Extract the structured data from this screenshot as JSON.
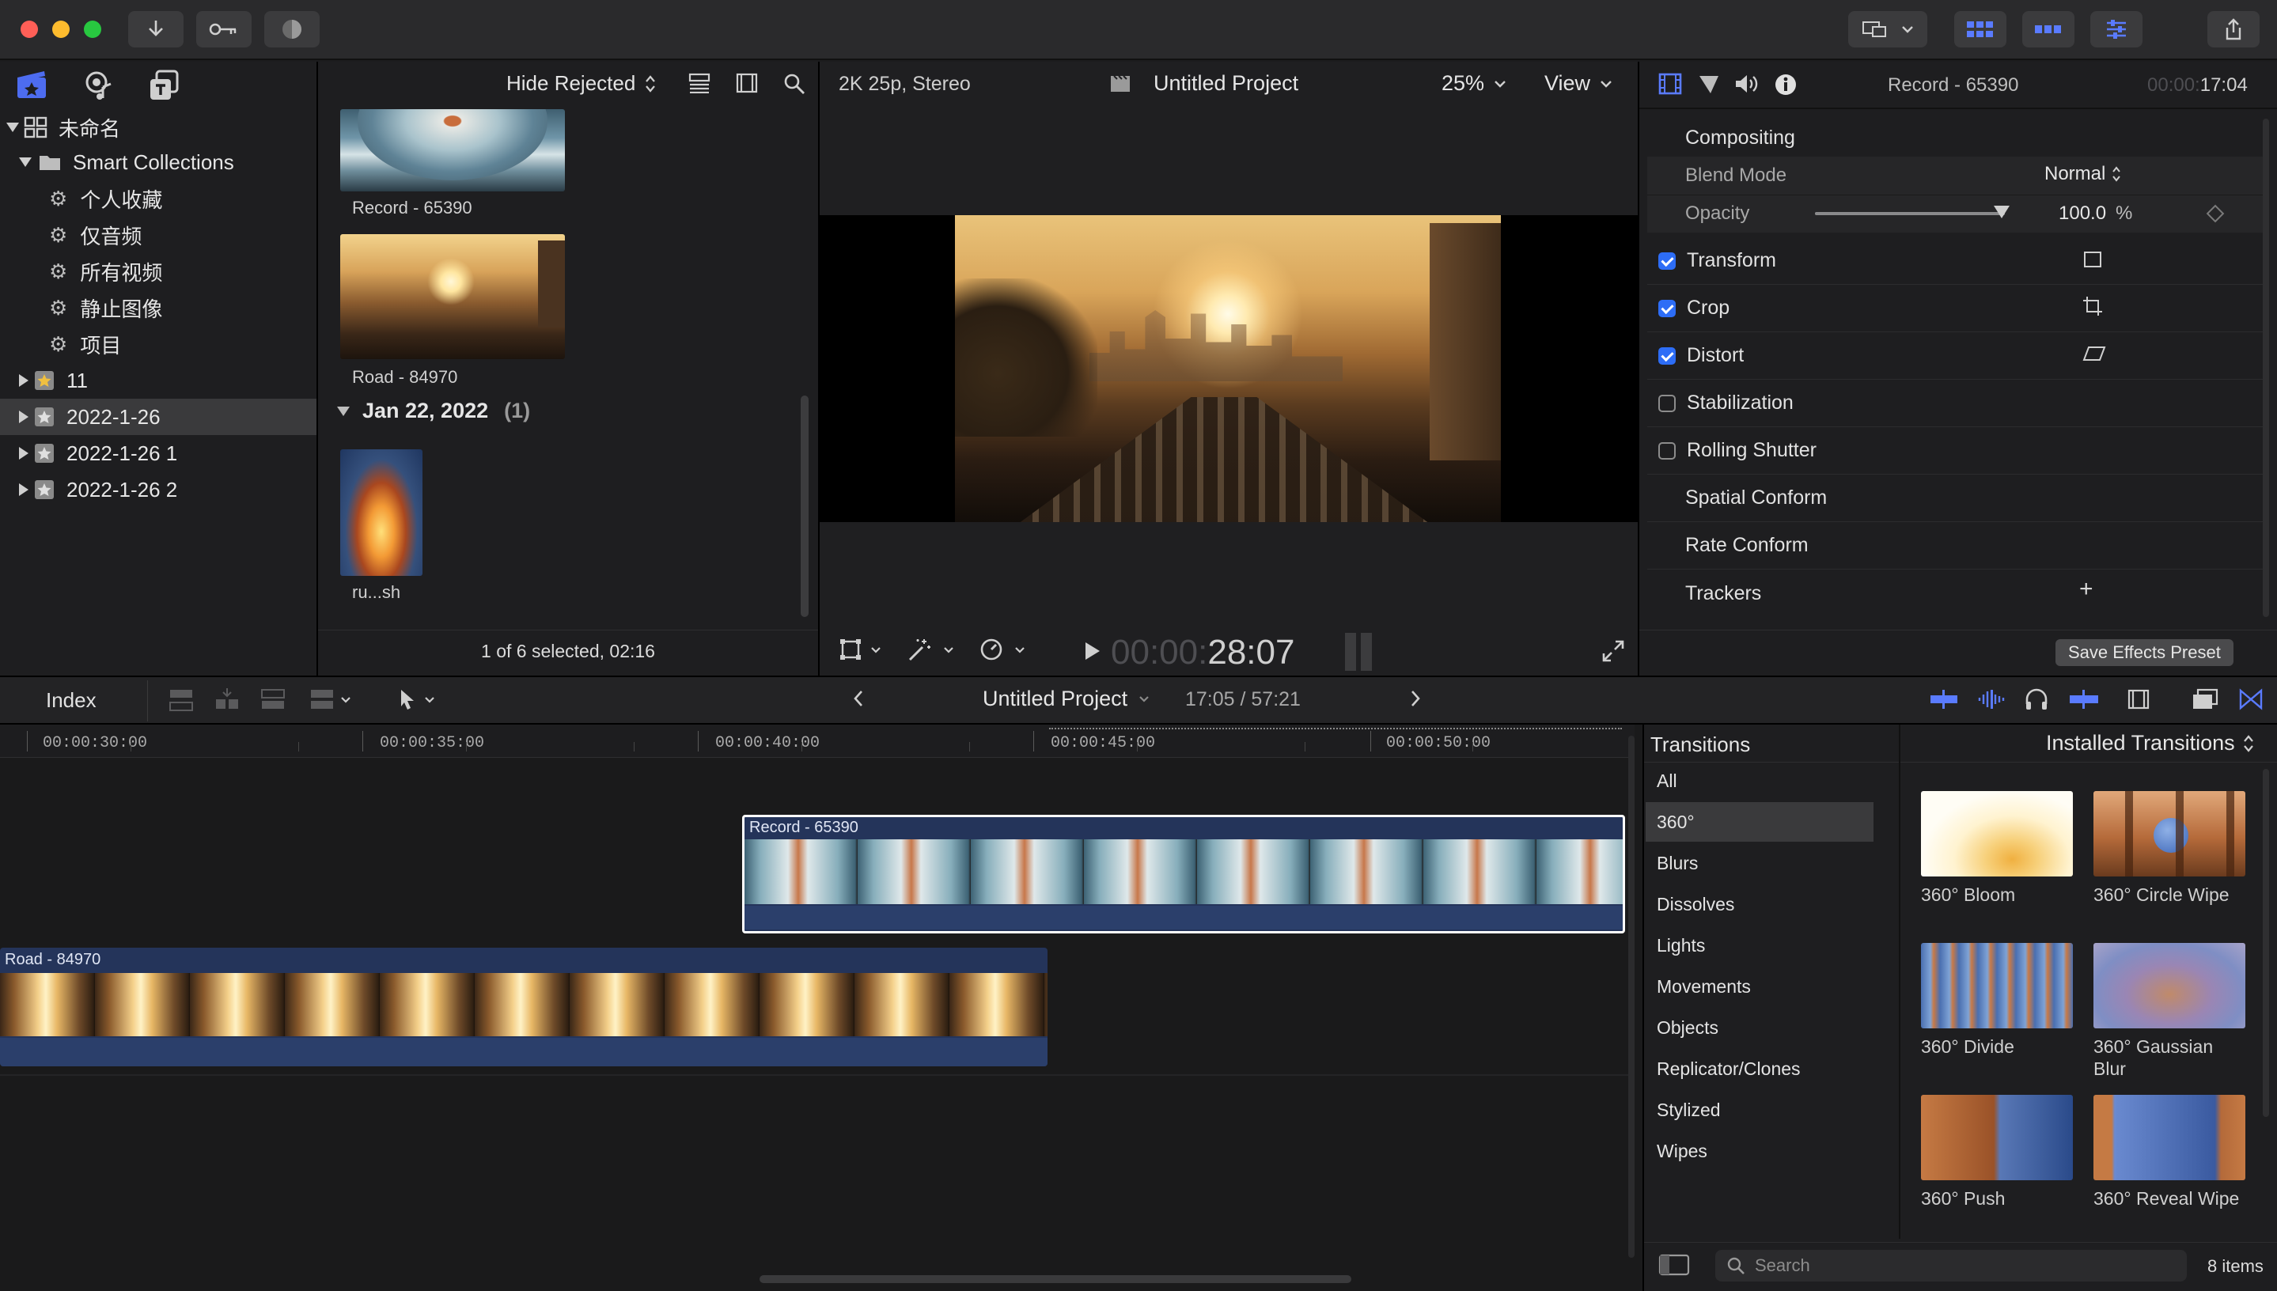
{
  "toolbar": {
    "import_icon": "download-arrow-icon",
    "keyword_icon": "key-icon",
    "bg_tasks_icon": "progress-circle-icon"
  },
  "browser_header": {
    "filter_label": "Hide Rejected"
  },
  "library": {
    "root": "未命名",
    "smart_collections_label": "Smart Collections",
    "smart_items": [
      "个人收藏",
      "仅音频",
      "所有视频",
      "静止图像",
      "项目"
    ],
    "events": [
      "11",
      "2022-1-26",
      "2022-1-26 1",
      "2022-1-26 2"
    ],
    "selected_event": "2022-1-26"
  },
  "browser": {
    "clips": [
      {
        "label": "Record - 65390"
      },
      {
        "label": "Road - 84970"
      }
    ],
    "date_group": "Jan 22, 2022",
    "date_group_count": "(1)",
    "clip3_label": "ru...sh",
    "status": "1 of 6 selected, 02:16"
  },
  "viewer": {
    "format": "2K 25p, Stereo",
    "project_title": "Untitled Project",
    "zoom": "25%",
    "view_label": "View",
    "timecode_dim": "00:00:",
    "timecode_main": "28:07"
  },
  "inspector": {
    "clip_name": "Record - 65390",
    "time_dim": "00:00:",
    "time_main": "17:04",
    "compositing_label": "Compositing",
    "blend_mode_label": "Blend Mode",
    "blend_mode_value": "Normal",
    "opacity_label": "Opacity",
    "opacity_value": "100.0",
    "opacity_unit": "%",
    "opacity_level": 1.0,
    "rows": [
      {
        "label": "Transform",
        "checked": true
      },
      {
        "label": "Crop",
        "checked": true
      },
      {
        "label": "Distort",
        "checked": true
      },
      {
        "label": "Stabilization",
        "checked": false
      },
      {
        "label": "Rolling Shutter",
        "checked": false
      }
    ],
    "spatial_conform": "Spatial Conform",
    "rate_conform": "Rate Conform",
    "trackers": "Trackers",
    "trackers_add": "+",
    "save_preset": "Save Effects Preset"
  },
  "timeline_bar": {
    "index_label": "Index",
    "project_title": "Untitled Project",
    "time": "17:05 / 57:21"
  },
  "ruler": [
    "00:00:30:00",
    "00:00:35:00",
    "00:00:40:00",
    "00:00:45:00",
    "00:00:50:00"
  ],
  "timeline": {
    "clip_upper": "Record - 65390",
    "clip_lower": "Road - 84970"
  },
  "transitions": {
    "header": "Transitions",
    "installed_label": "Installed Transitions",
    "categories": [
      "All",
      "360°",
      "Blurs",
      "Dissolves",
      "Lights",
      "Movements",
      "Objects",
      "Replicator/Clones",
      "Stylized",
      "Wipes"
    ],
    "selected_category": "360°",
    "items": [
      {
        "label": "360° Bloom"
      },
      {
        "label": "360° Circle Wipe"
      },
      {
        "label": "360° Divide"
      },
      {
        "label": "360° Gaussian Blur"
      },
      {
        "label": "360° Push"
      },
      {
        "label": "360° Reveal Wipe"
      }
    ],
    "gaussian_line1": "360° Gaussian",
    "gaussian_line2": "Blur",
    "search_placeholder": "Search",
    "count": "8 items"
  },
  "colors": {
    "accent": "#2d6df6",
    "selected_clip_border": "#ffffff",
    "clip_bg": "#24345a"
  }
}
